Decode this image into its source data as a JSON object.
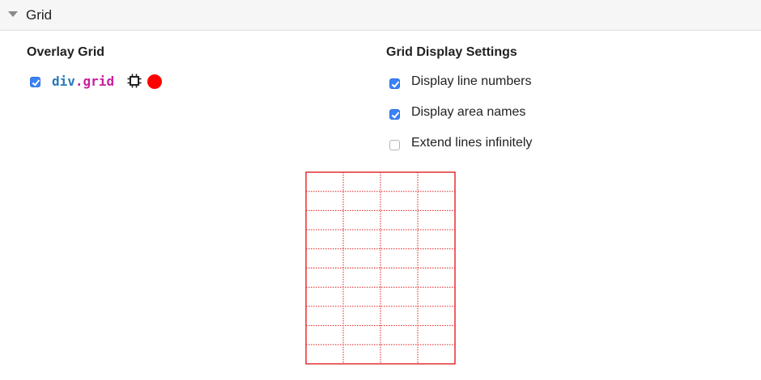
{
  "section": {
    "title": "Grid",
    "expanded": true
  },
  "overlay_grid": {
    "title": "Overlay Grid",
    "items": [
      {
        "checked": true,
        "tag": "div",
        "class_name": ".grid",
        "icon": "node-target-icon",
        "overlay_color": "#ff0000"
      }
    ]
  },
  "display_settings": {
    "title": "Grid Display Settings",
    "options": [
      {
        "label": "Display line numbers",
        "checked": true
      },
      {
        "label": "Display area names",
        "checked": true
      },
      {
        "label": "Extend lines infinitely",
        "checked": false
      }
    ]
  },
  "grid_preview": {
    "columns": 4,
    "rows": 10,
    "line_color": "#e02020"
  }
}
